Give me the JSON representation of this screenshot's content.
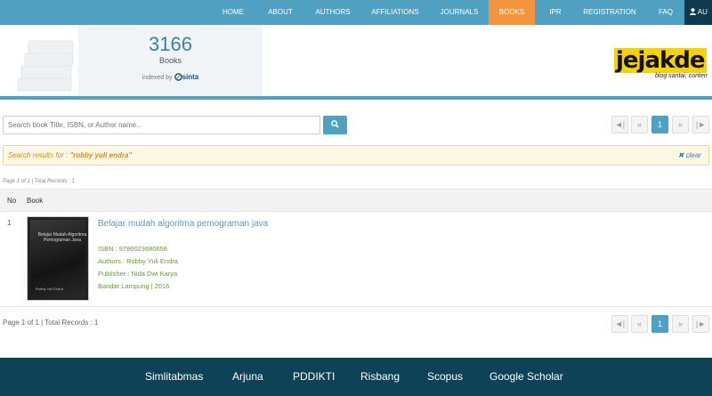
{
  "nav": {
    "items": [
      {
        "label": "HOME"
      },
      {
        "label": "ABOUT"
      },
      {
        "label": "AUTHORS"
      },
      {
        "label": "AFFILIATIONS"
      },
      {
        "label": "JOURNALS"
      },
      {
        "label": "BOOKS",
        "active": true
      },
      {
        "label": "IPR"
      },
      {
        "label": "REGISTRATION"
      },
      {
        "label": "FAQ"
      }
    ],
    "user_label": "AU"
  },
  "stats": {
    "count": "3166",
    "label": "Books",
    "indexed_by": "indexed by",
    "indexer": "sinta"
  },
  "logo": {
    "text": "jejakde",
    "subtitle": "blog santai, conten"
  },
  "search": {
    "placeholder": "Search book Title, ISBN, or Author name..",
    "button_icon": "search-icon"
  },
  "pagination": {
    "first_icon": "first-page-icon",
    "prev_icon": "prev-page-icon",
    "current": "1",
    "next_icon": "next-page-icon",
    "last_icon": "last-page-icon"
  },
  "alert": {
    "prefix": "Search results for : ",
    "query": "\"robby yuli endra\"",
    "clear": "clear"
  },
  "page_info_top": "Page 1 of 1 | Total Records : 1",
  "table": {
    "headers": {
      "no": "No",
      "book": "Book"
    },
    "rows": [
      {
        "no": "1",
        "title": "Belajar mudah algoritma pemograman java",
        "isbn": "ISBN : 9786023680658",
        "authors": "Authors : Robby Yuli Endra",
        "publisher": "Publisher : Nida Dwi Karya",
        "place": "Bandar Lampung | 2016",
        "cover_title": "Belajar Mudah Algoritma Pemograman Java",
        "cover_author": "Robby Yuli Endra"
      }
    ]
  },
  "page_info_bottom": "Page 1 of 1 | Total Records : 1",
  "footer": {
    "links": [
      "Simlitabmas",
      "Arjuna",
      "PDDIKTI",
      "Risbang",
      "Scopus",
      "Google Scholar"
    ]
  },
  "colors": {
    "nav_bg": "#4fa0c1",
    "active_tab": "#f4953e",
    "footer_bg": "#0d4257",
    "alert_bg": "#fcf8e3"
  }
}
